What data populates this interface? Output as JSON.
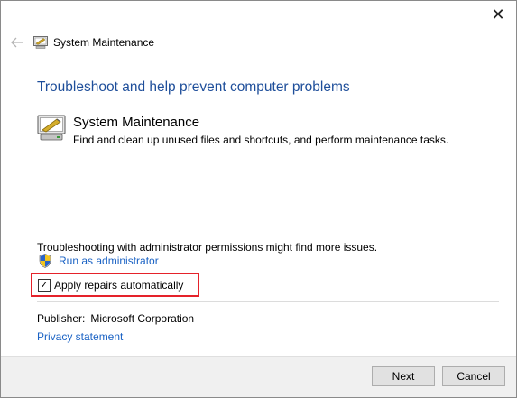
{
  "window": {
    "close_glyph": "✕",
    "back_glyph": "🡐"
  },
  "header": {
    "title": "System Maintenance",
    "icon": "system-maintenance-icon"
  },
  "main": {
    "heading": "Troubleshoot and help prevent computer problems",
    "troubleshooter": {
      "title": "System Maintenance",
      "description": "Find and clean up unused files and shortcuts, and perform maintenance tasks.",
      "icon": "system-maintenance-icon"
    },
    "admin_note": "Troubleshooting with administrator permissions might find more issues.",
    "run_as_admin": {
      "label": "Run as administrator",
      "icon": "uac-shield-icon"
    },
    "apply_repairs": {
      "label": "Apply repairs automatically",
      "checked": true,
      "check_glyph": "✓"
    },
    "publisher": {
      "label": "Publisher:",
      "value": "Microsoft Corporation"
    },
    "privacy_link": "Privacy statement"
  },
  "footer": {
    "next_label": "Next",
    "cancel_label": "Cancel"
  },
  "colors": {
    "heading": "#1e4e9a",
    "link": "#1a62c4",
    "highlight_border": "#e5222a"
  }
}
